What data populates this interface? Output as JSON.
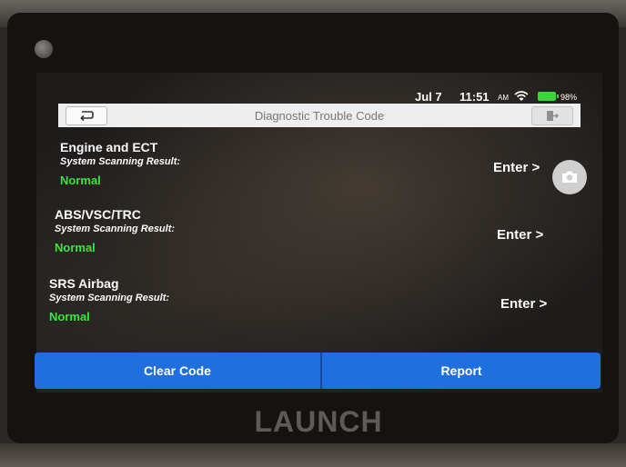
{
  "status_bar": {
    "date": "Jul 7",
    "time": "11:51",
    "ampm": "AM",
    "battery": "98%",
    "wifi_icon": "wifi-icon",
    "battery_icon": "battery-icon"
  },
  "header": {
    "title": "Diagnostic Trouble Code",
    "back_icon": "back-arrow-icon",
    "exit_icon": "exit-icon"
  },
  "systems": [
    {
      "name": "Engine and ECT",
      "result_label": "System Scanning Result:",
      "status": "Normal",
      "enter_label": "Enter >"
    },
    {
      "name": "ABS/VSC/TRC",
      "result_label": "System Scanning Result:",
      "status": "Normal",
      "enter_label": "Enter >"
    },
    {
      "name": "SRS Airbag",
      "result_label": "System Scanning Result:",
      "status": "Normal",
      "enter_label": "Enter >"
    }
  ],
  "buttons": {
    "clear_code": "Clear Code",
    "report": "Report"
  },
  "brand": "LAUNCH",
  "colors": {
    "accent_blue": "#1f6fe0",
    "status_green": "#39e63c"
  }
}
